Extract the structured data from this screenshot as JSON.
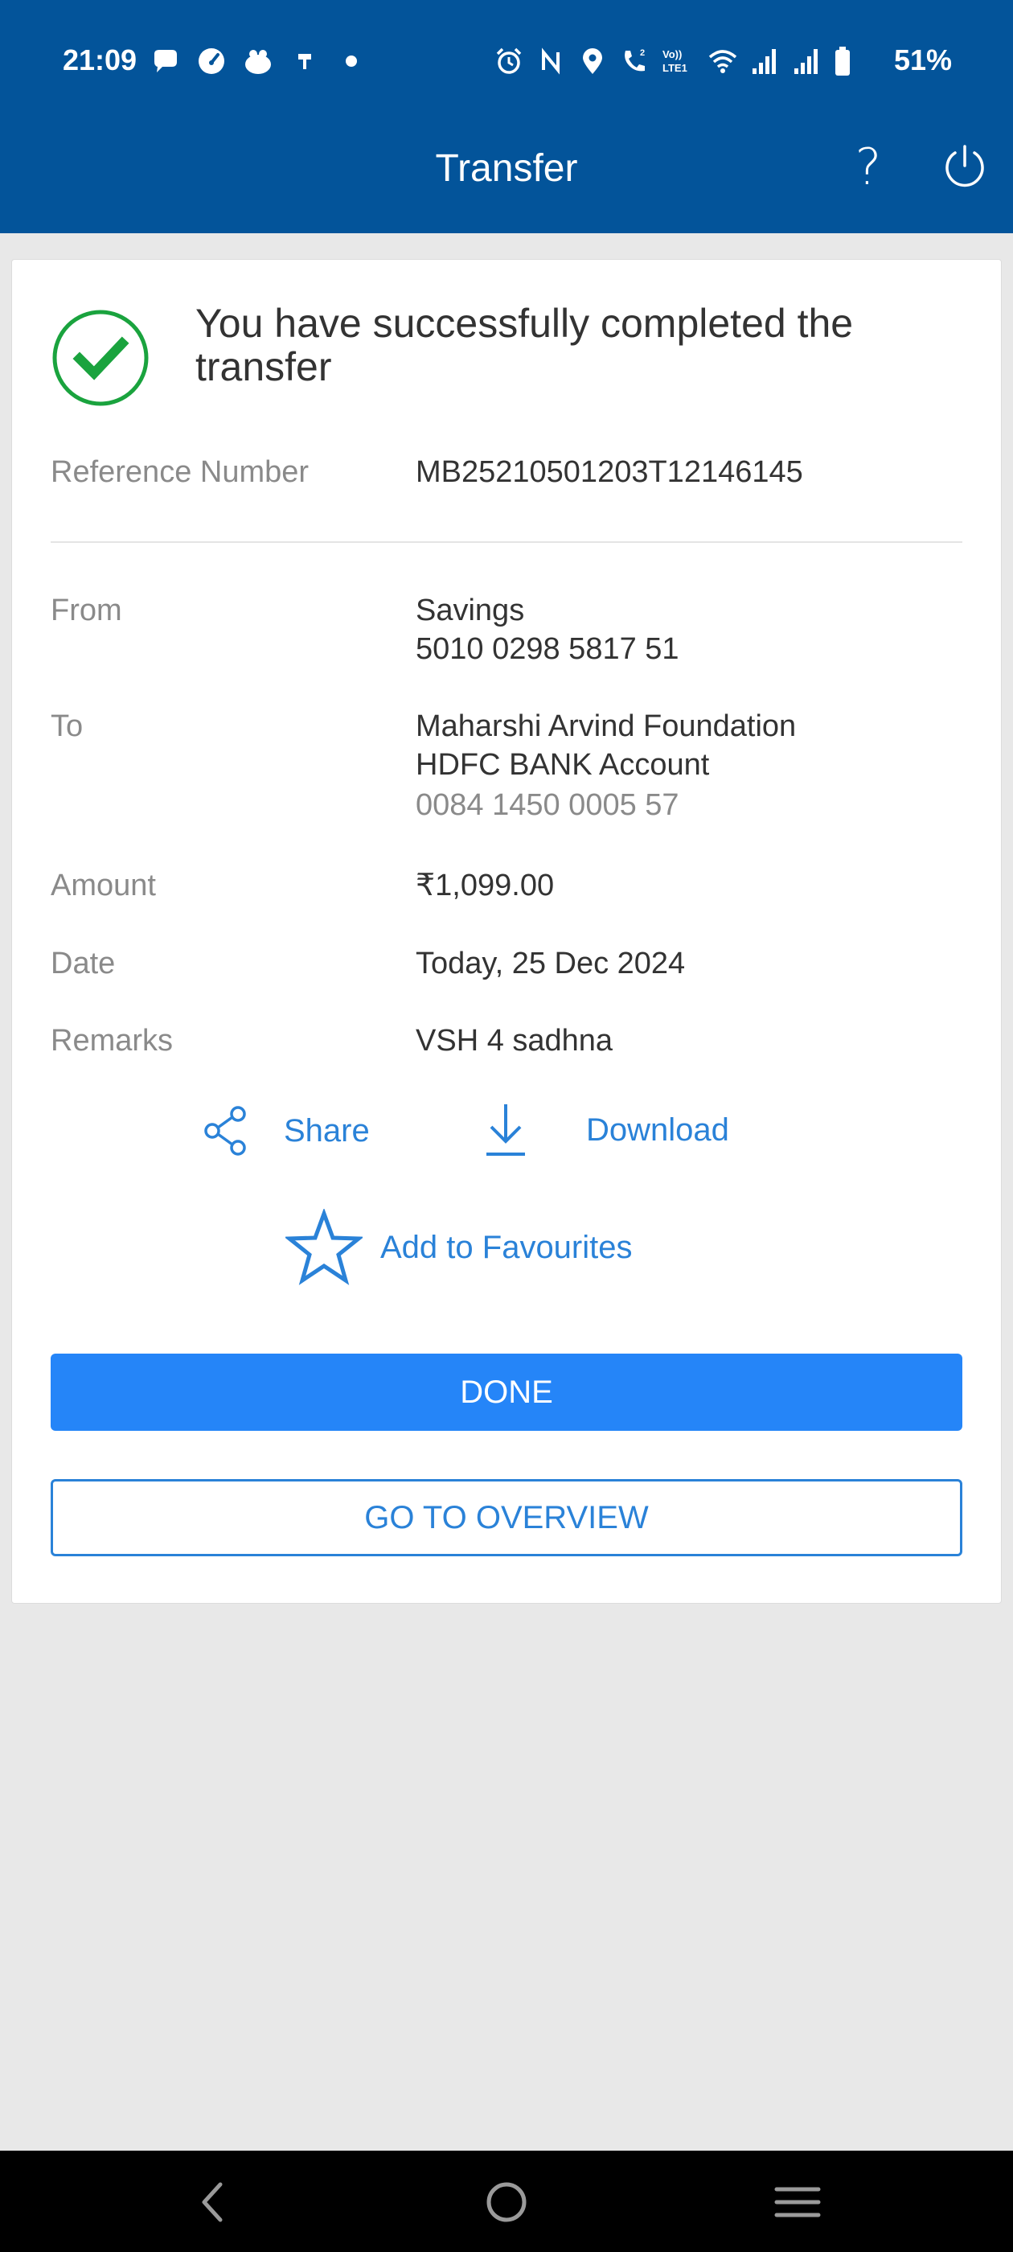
{
  "status_bar": {
    "time": "21:09",
    "battery": "51%",
    "left_icons": [
      "chat-icon",
      "speedometer-icon",
      "cloud-icon",
      "pin-icon",
      "dot-icon"
    ],
    "right_icons": [
      "alarm-icon",
      "nfc-icon",
      "location-icon",
      "wifi-calling-icon",
      "volte-icon",
      "wifi-icon",
      "signal-icon",
      "signal-icon",
      "battery-icon"
    ],
    "volte_label": "Vo)) LTE1"
  },
  "header": {
    "title": "Transfer",
    "help_label": "?"
  },
  "confirmation": {
    "message": "You have successfully completed the transfer",
    "reference_label": "Reference Number",
    "reference_value": "MB25210501203T12146145"
  },
  "details": {
    "from_label": "From",
    "from_account_type": "Savings",
    "from_account_number": "5010 0298 5817 51",
    "to_label": "To",
    "to_name": "Maharshi Arvind Foundation",
    "to_bank": "HDFC BANK Account",
    "to_account_number": "0084 1450 0005 57",
    "amount_label": "Amount",
    "amount_value": "₹1,099.00",
    "date_label": "Date",
    "date_value": "Today, 25 Dec 2024",
    "remarks_label": "Remarks",
    "remarks_value": "VSH 4 sadhna"
  },
  "actions": {
    "share_label": "Share",
    "download_label": "Download",
    "favourite_label": "Add to Favourites",
    "done_label": "DONE",
    "overview_label": "GO TO OVERVIEW"
  },
  "colors": {
    "header_bg": "#03549a",
    "accent": "#2a82d8",
    "primary_button": "#2585f8",
    "success_green": "#1aa33e",
    "page_bg": "#e8e8e8"
  }
}
